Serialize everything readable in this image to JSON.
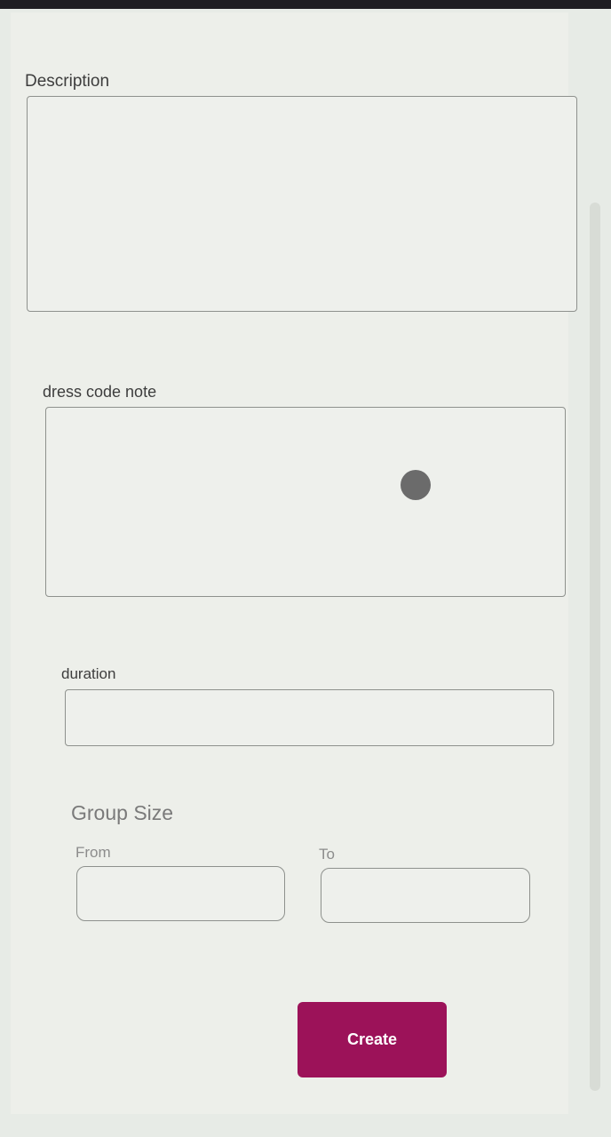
{
  "colors": {
    "accent": "#9c1259"
  },
  "form": {
    "description": {
      "label": "Description",
      "value": ""
    },
    "dress_code_note": {
      "label": "dress code note",
      "value": ""
    },
    "duration": {
      "label": "duration",
      "value": ""
    },
    "group_size": {
      "title": "Group Size",
      "from_label": "From",
      "from_value": "",
      "to_label": "To",
      "to_value": ""
    },
    "create_label": "Create"
  }
}
